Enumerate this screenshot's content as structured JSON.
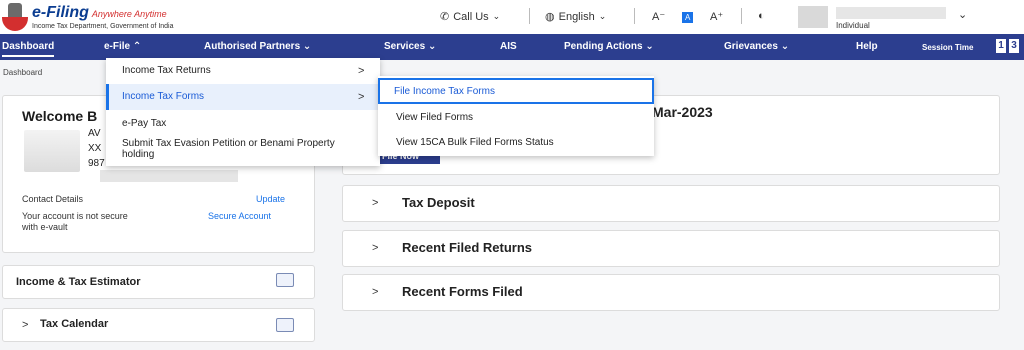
{
  "header": {
    "logo_main": "e-Filing",
    "logo_tagline": "Anywhere Anytime",
    "logo_sub": "Income Tax Department, Government of India",
    "call_us": "Call Us",
    "language": "English",
    "font_small": "A⁻",
    "font_normal": "A",
    "font_large": "A⁺",
    "contrast_icon": "contrast-icon",
    "user_role": "Individual"
  },
  "nav": {
    "items": [
      "Dashboard",
      "e-File",
      "Authorised Partners",
      "Services",
      "AIS",
      "Pending Actions",
      "Grievances",
      "Help"
    ],
    "session_label": "Session Time",
    "session_digits": [
      "1",
      "3"
    ]
  },
  "breadcrumb": "Dashboard",
  "welcome": {
    "title": "Welcome B",
    "line1": "AV",
    "line2": "XX",
    "line3": "987",
    "contact_label": "Contact Details",
    "update_link": "Update",
    "vault_text": "Your account is not secure with e-vault",
    "secure_link": "Secure Account"
  },
  "left_cards": {
    "estimator": "Income & Tax Estimator",
    "calendar_chevron": ">",
    "calendar": "Tax Calendar"
  },
  "main": {
    "notice_text": "Mar-2023",
    "file_now": "File Now",
    "panels": [
      "Tax Deposit",
      "Recent Filed Returns",
      "Recent Forms Filed"
    ],
    "chevron": ">"
  },
  "efile_menu": {
    "items": [
      "Income Tax Returns",
      "Income Tax Forms",
      "e-Pay Tax",
      "Submit Tax Evasion Petition or Benami Property holding"
    ],
    "arrow": ">"
  },
  "forms_submenu": {
    "items": [
      "File Income Tax Forms",
      "View Filed Forms",
      "View 15CA Bulk Filed Forms Status"
    ]
  },
  "colors": {
    "nav_bg": "#2c3e8f",
    "accent": "#1a73e8"
  }
}
